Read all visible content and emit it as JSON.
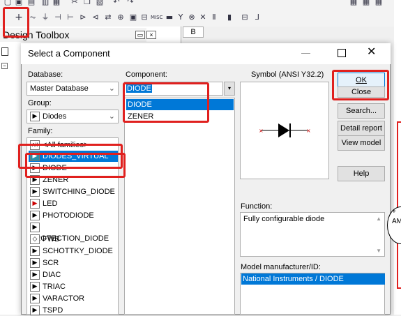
{
  "toolbar": {
    "row1_icons": [
      "new-icon",
      "open-icon",
      "save-icon",
      "print-icon",
      "print-preview-icon",
      "cut-icon",
      "copy-icon",
      "paste-icon",
      "undo-icon",
      "redo-icon"
    ],
    "row2_icons": [
      "place-component-icon",
      "source-icon",
      "basic-icon",
      "diode-icon",
      "transistor-icon",
      "analog-icon",
      "ttl-icon",
      "cmos-icon",
      "mcu-icon",
      "advanced-peripherals-icon",
      "misc-digital-icon",
      "mixed-icon",
      "indicator-icon",
      "power-icon",
      "misc-icon",
      "rf-icon",
      "electromechanical-icon",
      "ni-components-icon",
      "connector-icon",
      "hierarchical-block-icon",
      "bus-icon"
    ],
    "row2_glyphs": [
      "+",
      "⏦",
      "⏚",
      "⊣",
      "⊢",
      "⊳",
      "⊲",
      "⇄",
      "⊕",
      "MISC",
      "▬",
      "Y",
      "⊗",
      "✕",
      "Ⅱ",
      "▮",
      "⊟",
      "⅃"
    ]
  },
  "design_toolbox": {
    "title": "Design Toolbox",
    "tab_label": "B"
  },
  "dialog": {
    "title": "Select a Component",
    "database_label": "Database:",
    "database_value": "Master Database",
    "group_label": "Group:",
    "group_value": "Diodes",
    "family_label": "Family:",
    "families": [
      {
        "label": "<All families>",
        "glyph": "All"
      },
      {
        "label": "DIODES_VIRTUAL",
        "glyph": "▶"
      },
      {
        "label": "DIODE",
        "glyph": "▶"
      },
      {
        "label": "ZENER",
        "glyph": "▶"
      },
      {
        "label": "SWITCHING_DIODE",
        "glyph": "▶"
      },
      {
        "label": "LED",
        "glyph": "▶"
      },
      {
        "label": "PHOTODIODE",
        "glyph": "▶"
      },
      {
        "label": "PROTECTION_DIODE",
        "glyph": "▶"
      },
      {
        "label": "FWB",
        "glyph": "◇"
      },
      {
        "label": "SCHOTTKY_DIODE",
        "glyph": "▶"
      },
      {
        "label": "SCR",
        "glyph": "▶"
      },
      {
        "label": "DIAC",
        "glyph": "▶"
      },
      {
        "label": "TRIAC",
        "glyph": "▶"
      },
      {
        "label": "VARACTOR",
        "glyph": "▶"
      },
      {
        "label": "TSPD",
        "glyph": "▶"
      }
    ],
    "component_label": "Component:",
    "component_value": "DIODE",
    "components": [
      "DIODE",
      "ZENER"
    ],
    "symbol_label": "Symbol (ANSI Y32.2)",
    "buttons": {
      "ok": "OK",
      "close": "Close",
      "search": "Search...",
      "detail": "Detail report",
      "view_model": "View model",
      "help": "Help"
    },
    "function_label": "Function:",
    "function_value": "Fully configurable diode",
    "model_label": "Model manufacturer/ID:",
    "model_value": "National Instruments / DIODE"
  },
  "colors": {
    "highlight": "#e0201e",
    "selection": "#0078d7"
  }
}
